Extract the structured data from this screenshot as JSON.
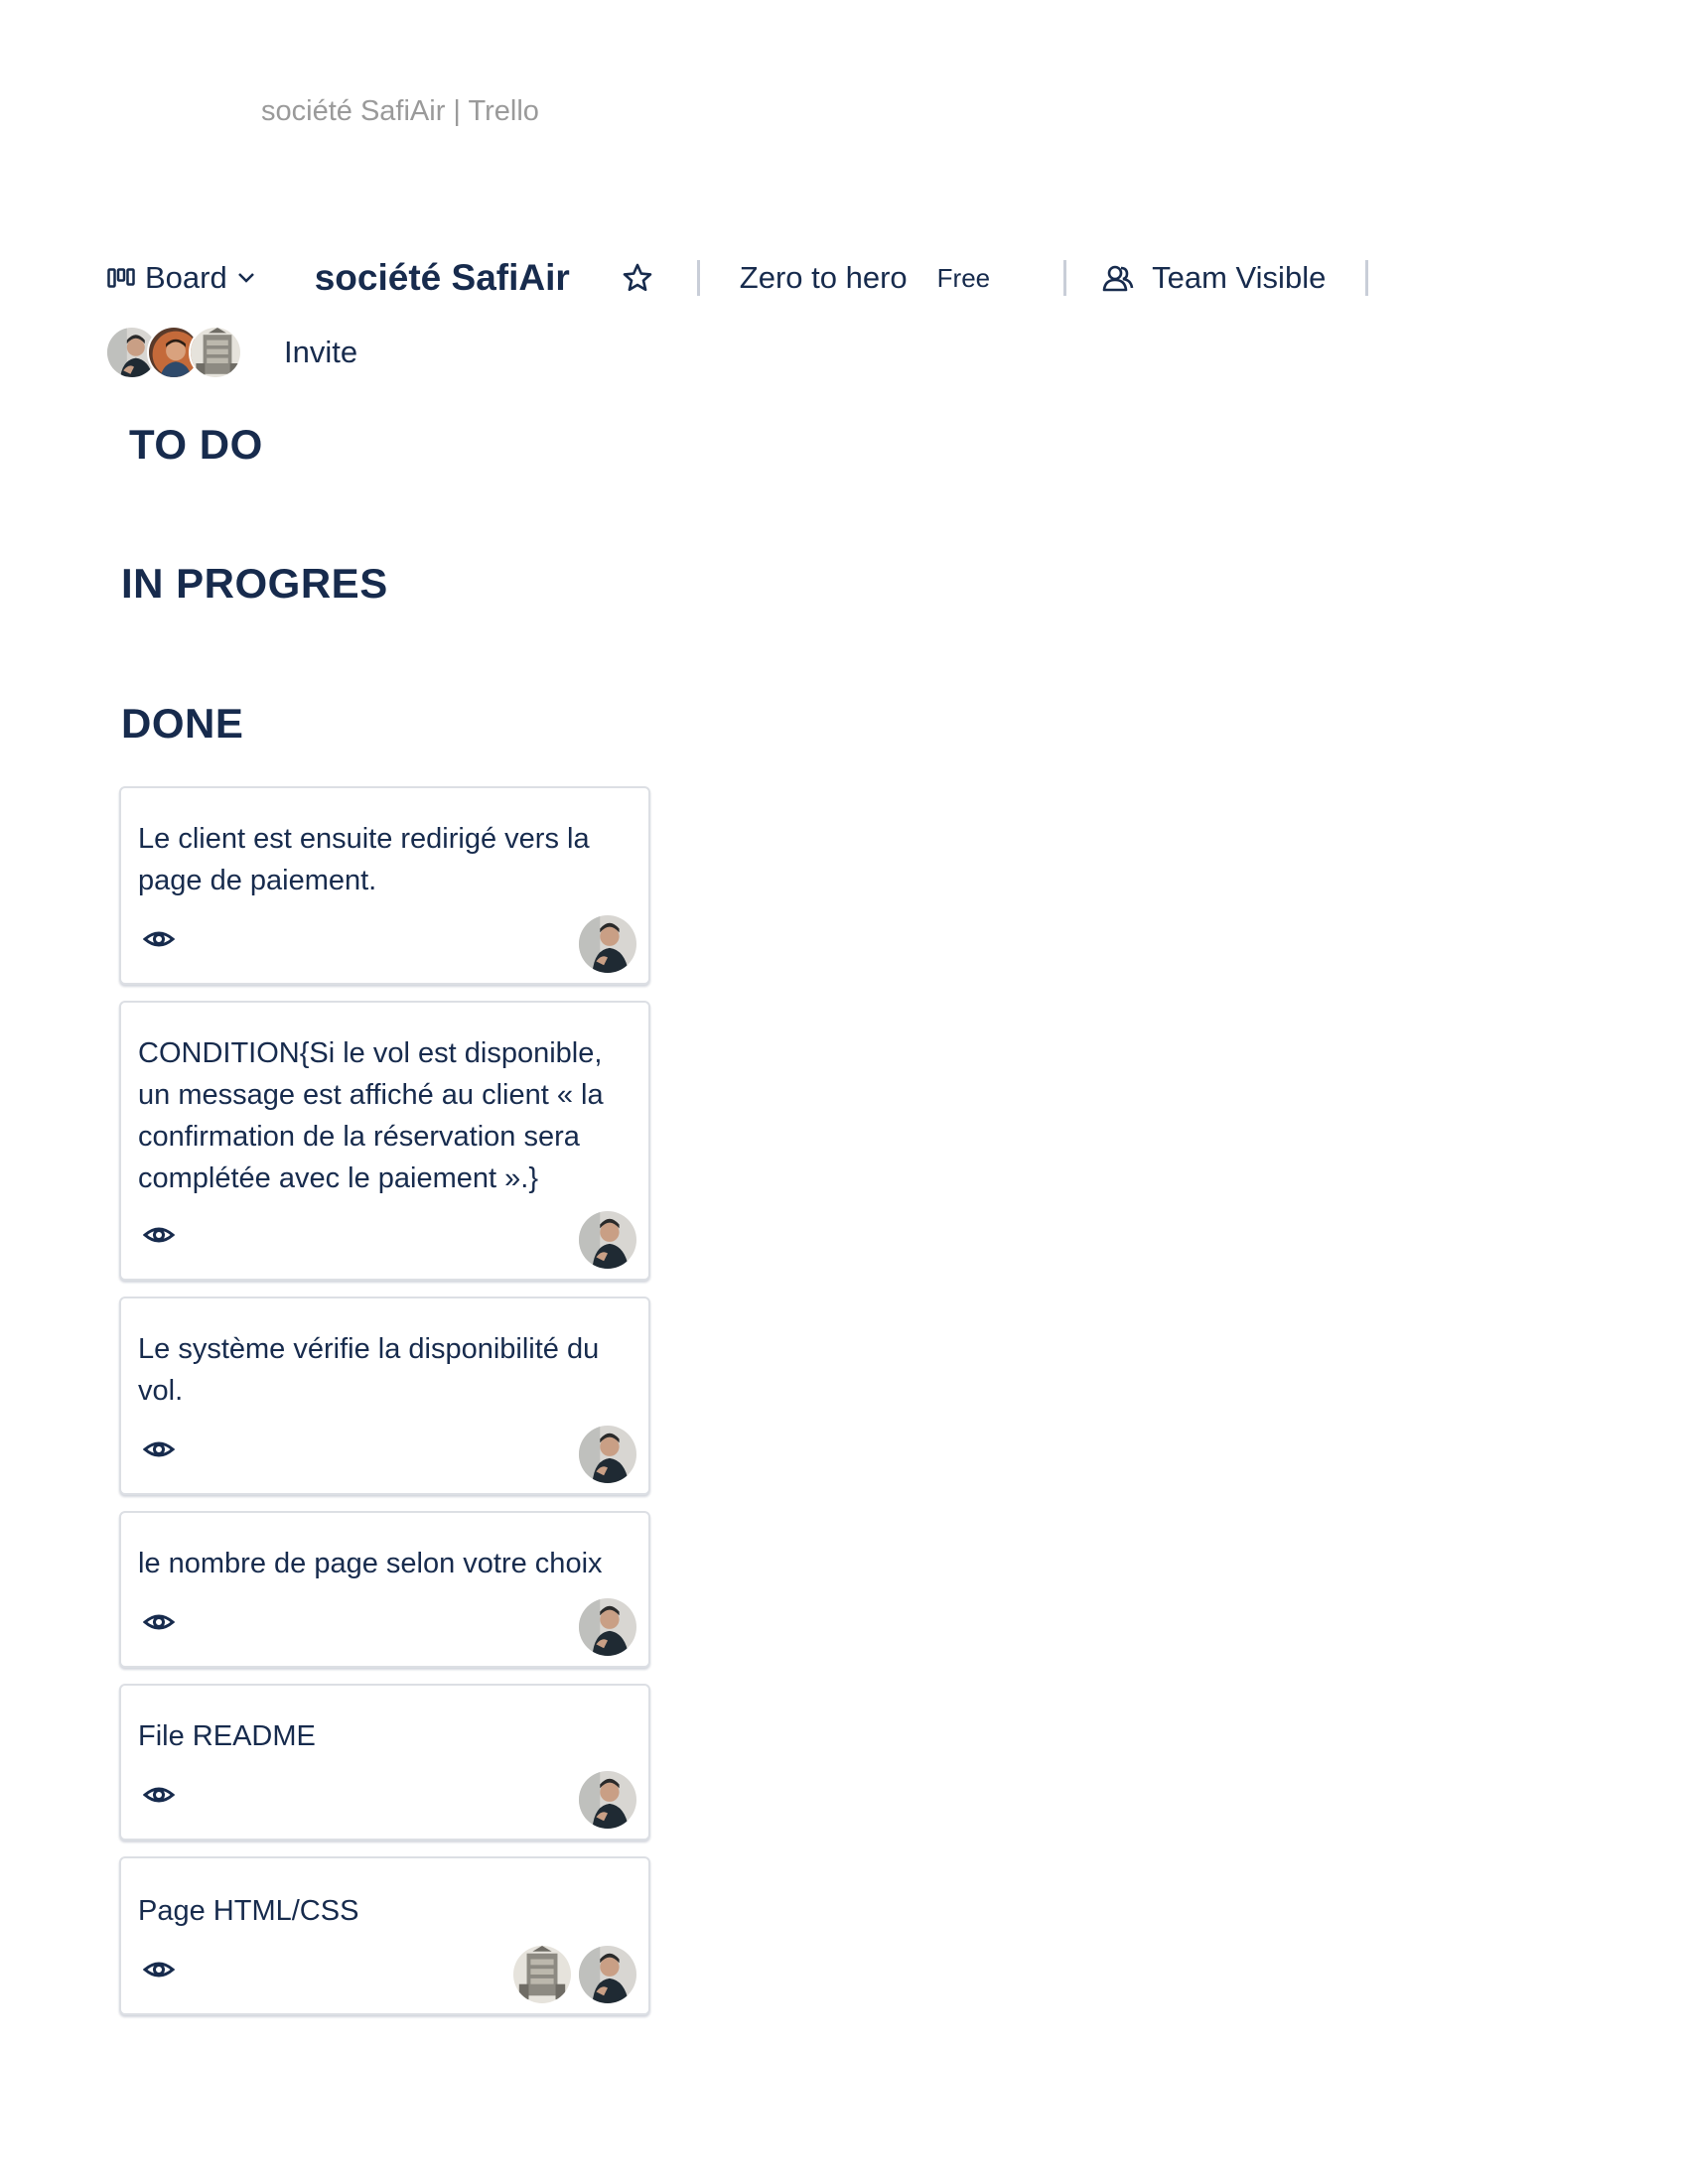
{
  "document": {
    "title": "société SafiAir | Trello"
  },
  "header": {
    "view_label": "Board",
    "board_name": "société SafiAir",
    "workspace_name": "Zero to hero",
    "plan_badge": "Free",
    "visibility_label": "Team Visible"
  },
  "members": {
    "invite_label": "Invite",
    "avatars": [
      "member-avatar-1",
      "member-avatar-2",
      "member-avatar-3"
    ]
  },
  "lists": [
    {
      "title": "TO DO"
    },
    {
      "title": "IN PROGRES"
    },
    {
      "title": "DONE"
    }
  ],
  "cards": [
    {
      "title": "Le client est ensuite redirigé vers la page de paiement.",
      "icon": "eye-icon",
      "members": [
        "member-avatar-1"
      ]
    },
    {
      "title": "CONDITION{Si le vol est disponible, un message est affiché au client « la confirmation de la réservation sera complétée avec le paiement ».}",
      "icon": "eye-icon",
      "members": [
        "member-avatar-1"
      ]
    },
    {
      "title": "Le système vérifie la disponibilité du vol.",
      "icon": "eye-icon",
      "members": [
        "member-avatar-1"
      ]
    },
    {
      "title": "le nombre de page selon votre choix",
      "icon": "eye-icon",
      "members": [
        "member-avatar-1"
      ]
    },
    {
      "title": "File README",
      "icon": "eye-icon",
      "members": [
        "member-avatar-1"
      ]
    },
    {
      "title": "Page HTML/CSS",
      "icon": "eye-icon",
      "members": [
        "member-avatar-3",
        "member-avatar-1"
      ]
    }
  ],
  "colors": {
    "text": "#172b4d",
    "muted": "#9a9a9a",
    "separator": "#c9ced8",
    "card_border": "#dcdfe4"
  }
}
